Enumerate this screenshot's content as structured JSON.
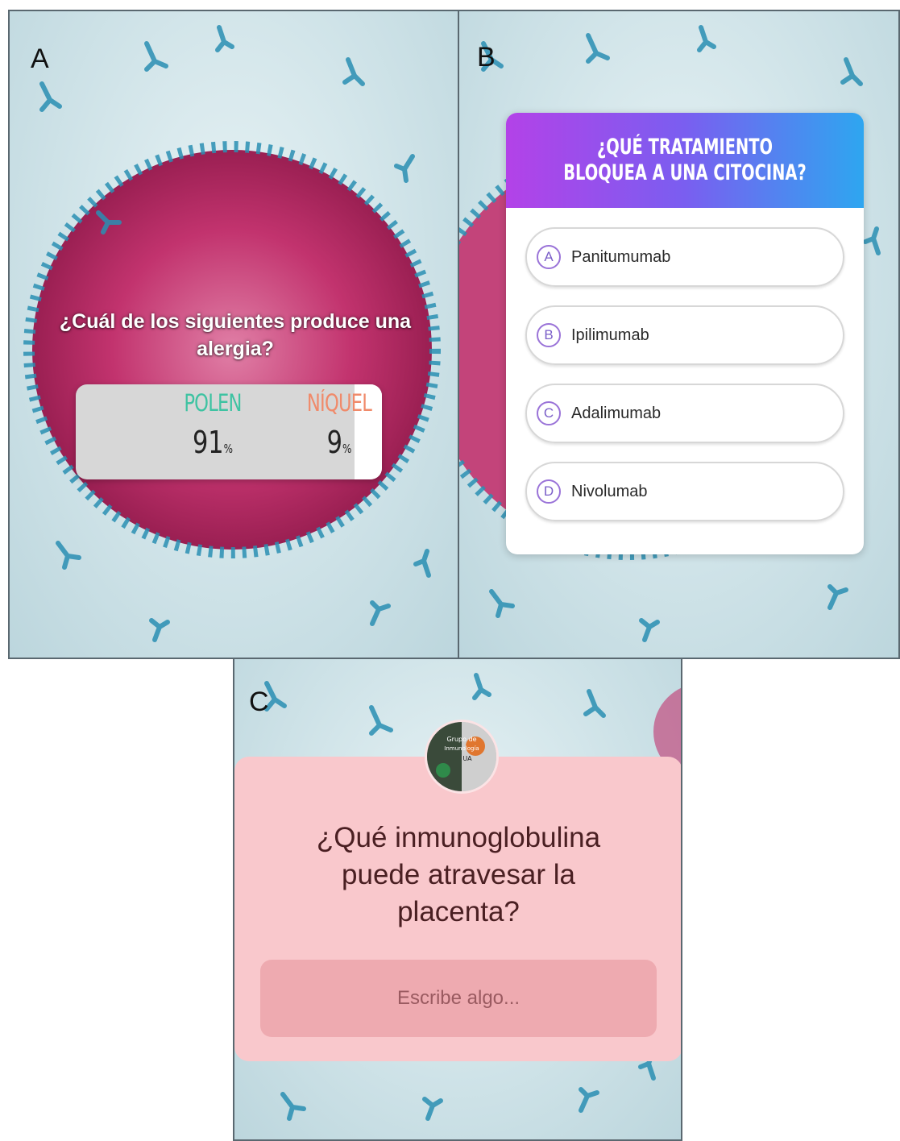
{
  "panels": {
    "a": {
      "letter": "A",
      "poll": {
        "question": "¿Cuál de los siguientes produce una alergia?",
        "options": [
          {
            "label": "POLEN",
            "percent": "91",
            "color": "#3ec3a2"
          },
          {
            "label": "NÍQUEL",
            "percent": "9",
            "color": "#f08a6a"
          }
        ],
        "percent_sign": "%"
      }
    },
    "b": {
      "letter": "B",
      "quiz": {
        "title": "¿QUÉ TRATAMIENTO BLOQUEA A UNA CITOCINA?",
        "options": [
          {
            "letter": "A",
            "text": "Panitumumab"
          },
          {
            "letter": "B",
            "text": "Ipilimumab"
          },
          {
            "letter": "C",
            "text": "Adalimumab"
          },
          {
            "letter": "D",
            "text": "Nivolumab"
          }
        ]
      }
    },
    "c": {
      "letter": "C",
      "question_box": {
        "question": "¿Qué inmunoglobulina puede atravesar la placenta?",
        "placeholder": "Escribe algo...",
        "avatar_text": [
          "Grupo de",
          "Inmunología",
          "UA"
        ]
      }
    }
  },
  "colors": {
    "quiz_gradient": [
      "#b342e8",
      "#2ea6f0"
    ],
    "question_card": "#f9c8cc",
    "antibody": "#2a8fb3",
    "cell": "#c2336e"
  }
}
